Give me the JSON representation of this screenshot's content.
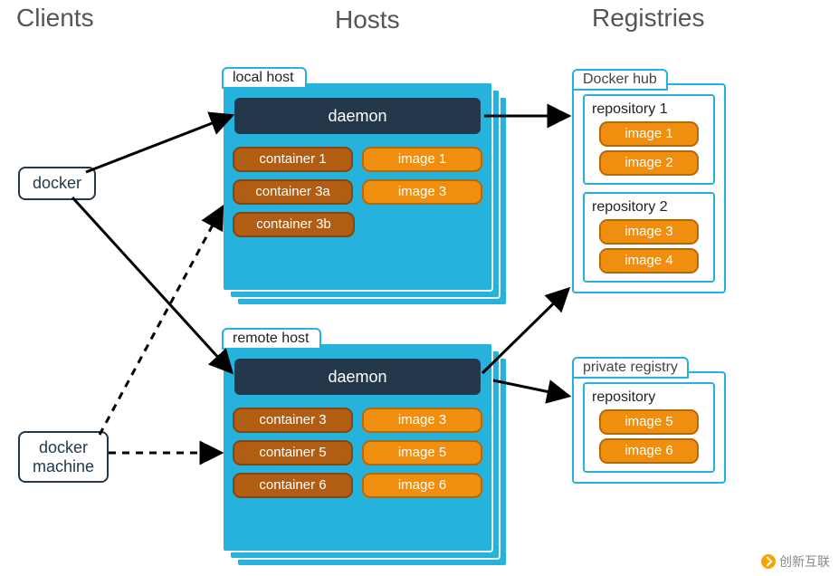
{
  "titles": {
    "clients": "Clients",
    "hosts": "Hosts",
    "registries": "Registries"
  },
  "clients": {
    "docker": "docker",
    "docker_machine_line1": "docker",
    "docker_machine_line2": "machine"
  },
  "hosts": {
    "local": {
      "tab": "local host",
      "daemon": "daemon",
      "rows": [
        {
          "container": "container 1",
          "image": "image 1"
        },
        {
          "container": "container 3a",
          "image": "image 3"
        },
        {
          "container": "container 3b",
          "image": null
        }
      ]
    },
    "remote": {
      "tab": "remote host",
      "daemon": "daemon",
      "rows": [
        {
          "container": "container 3",
          "image": "image 3"
        },
        {
          "container": "container 5",
          "image": "image 5"
        },
        {
          "container": "container 6",
          "image": "image 6"
        }
      ]
    }
  },
  "registries": {
    "hub": {
      "tab": "Docker hub",
      "repos": [
        {
          "title": "repository 1",
          "images": [
            "image 1",
            "image 2"
          ]
        },
        {
          "title": "repository 2",
          "images": [
            "image 3",
            "image 4"
          ]
        }
      ]
    },
    "private": {
      "tab": "private registry",
      "repos": [
        {
          "title": "repository",
          "images": [
            "image 5",
            "image 6"
          ]
        }
      ]
    }
  },
  "watermark": "创新互联"
}
